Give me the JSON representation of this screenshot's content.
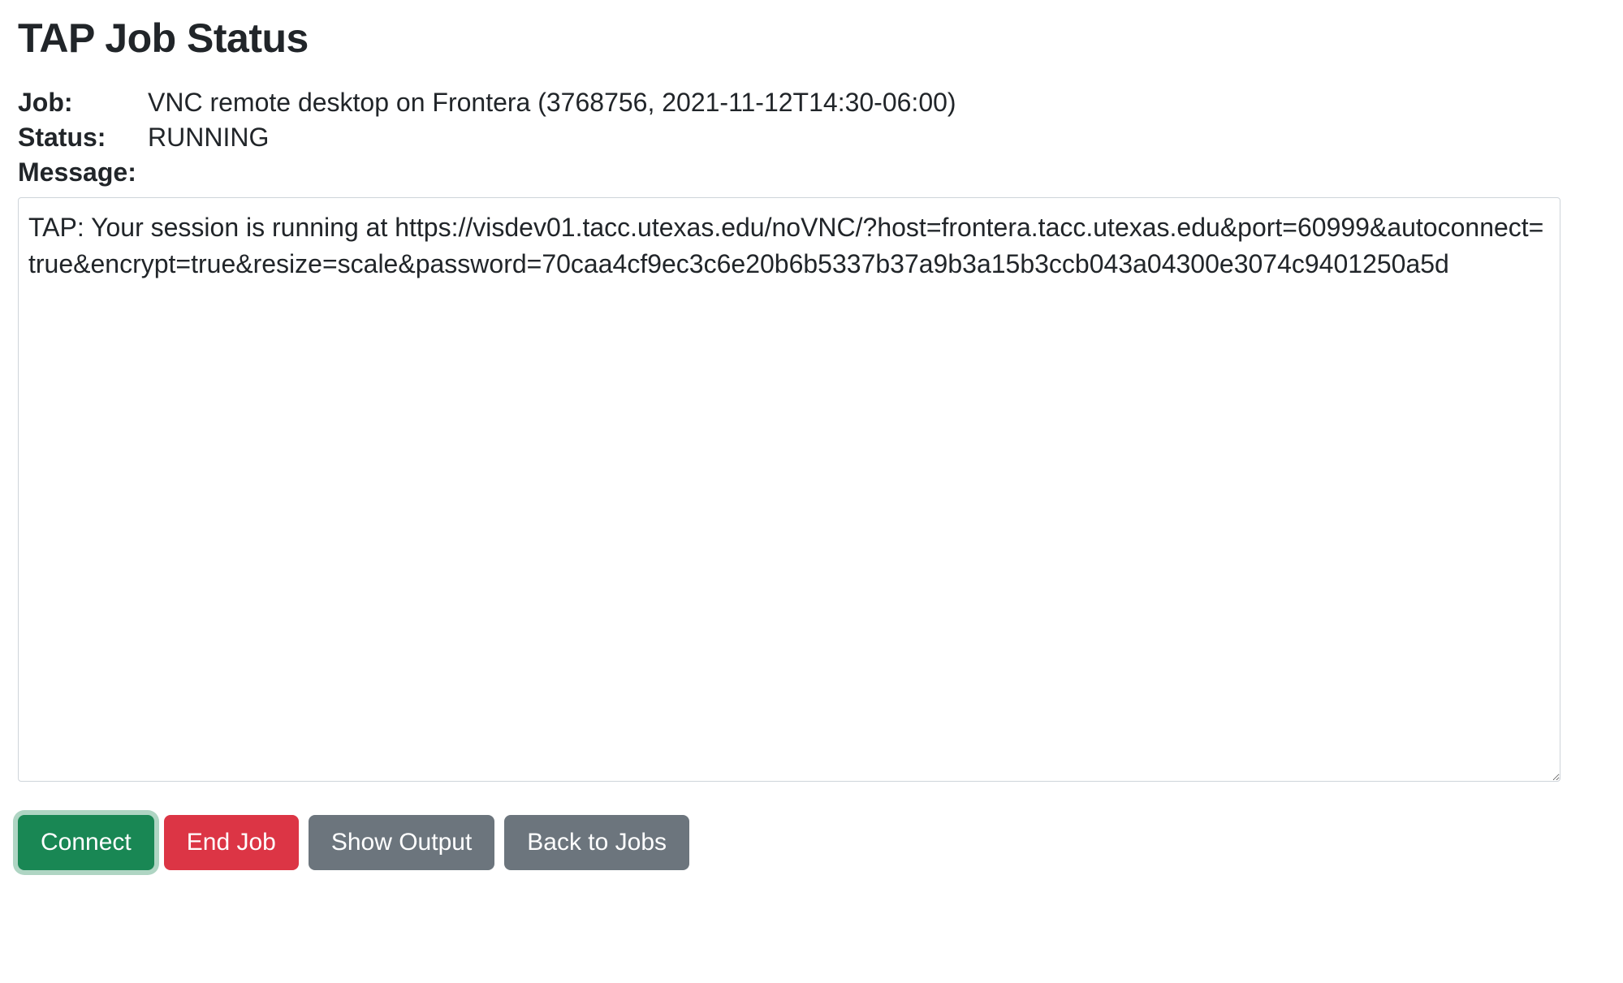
{
  "page": {
    "title": "TAP Job Status"
  },
  "job": {
    "label": "Job:",
    "value": "VNC remote desktop on Frontera (3768756, 2021-11-12T14:30-06:00)"
  },
  "status": {
    "label": "Status:",
    "value": "RUNNING"
  },
  "message": {
    "label": "Message:",
    "text": "TAP: Your session is running at https://visdev01.tacc.utexas.edu/noVNC/?host=frontera.tacc.utexas.edu&port=60999&autoconnect=true&encrypt=true&resize=scale&password=70caa4cf9ec3c6e20b6b5337b37a9b3a15b3ccb043a04300e3074c9401250a5d"
  },
  "actions": {
    "connect": "Connect",
    "end_job": "End Job",
    "show_output": "Show Output",
    "back_to_jobs": "Back to Jobs"
  }
}
